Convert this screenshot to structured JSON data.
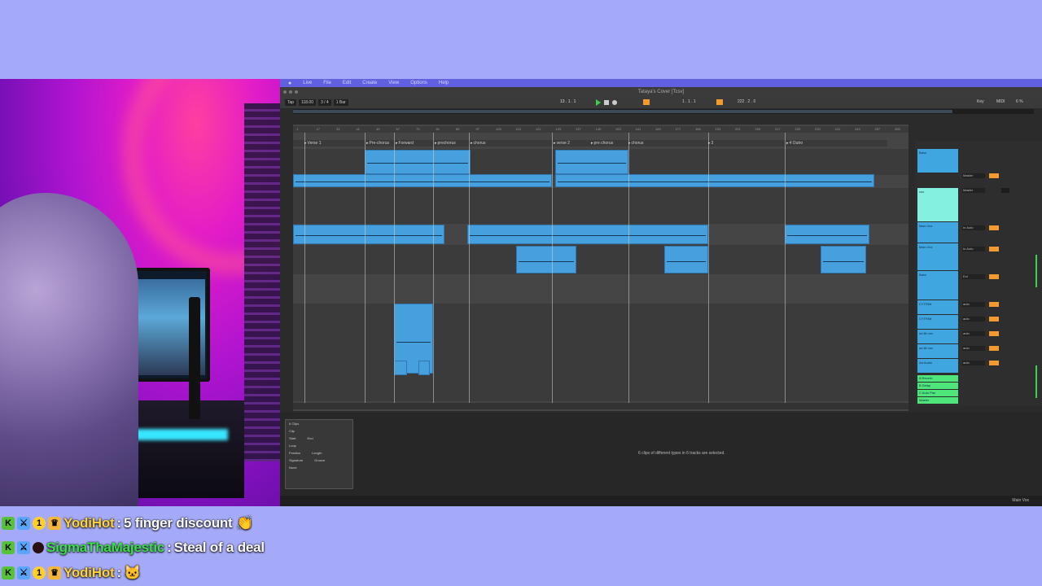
{
  "daw": {
    "menu": [
      "Live",
      "File",
      "Edit",
      "Create",
      "View",
      "Options",
      "Help"
    ],
    "window_title": "Tataya's Cover [Tcsv]",
    "tempo": "118.00",
    "signature": "3 / 4",
    "quantize": "1 Bar",
    "tap_label": "Tap",
    "position": "13 . 1 . 1",
    "loop_start": "1 . 1 . 1",
    "loop_length": "222 . 2 . 0",
    "key_label": "Key",
    "midi_label": "MIDI",
    "cpu": "6 %",
    "ruler_ticks": [
      "1",
      "17",
      "33",
      "41",
      "49",
      "57",
      "73",
      "81",
      "89",
      "97",
      "105",
      "113",
      "121",
      "129",
      "137",
      "145",
      "153",
      "161",
      "169",
      "177",
      "185",
      "193",
      "201",
      "209",
      "217",
      "225",
      "233",
      "241",
      "249",
      "257",
      "265"
    ],
    "locators": [
      {
        "label": "Verse 1"
      },
      {
        "label": "Pre-chorus"
      },
      {
        "label": "Forward"
      },
      {
        "label": "prechorus"
      },
      {
        "label": "chorus"
      },
      {
        "label": "verse 2"
      },
      {
        "label": "pre chorus"
      },
      {
        "label": "chorus"
      },
      {
        "label": "3"
      },
      {
        "label": "4 Outro"
      }
    ],
    "mixer_tracks": [
      {
        "name": "Bass",
        "io": "Master"
      },
      {
        "name": "vox",
        "io": "Master"
      },
      {
        "name": "Main Vox",
        "io": "In Auto"
      },
      {
        "name": "Main Vox",
        "io": "In Auto"
      },
      {
        "name": "Bass",
        "io": "Ext"
      },
      {
        "name": "CYTRIM",
        "io": "auto"
      },
      {
        "name": "CYTRIM",
        "io": "auto"
      },
      {
        "name": "ad-lib vox",
        "io": "auto"
      },
      {
        "name": "ad-lib vox",
        "io": "auto"
      },
      {
        "name": "Ad Audio",
        "io": "auto"
      }
    ],
    "returns": [
      "A Reverb",
      "B Delay",
      "C Auto Pan",
      "Master"
    ],
    "clip_panel": {
      "title": "6 Clips",
      "clip_label": "Clip",
      "start": "Start",
      "end": "End",
      "loop": "Loop",
      "position": "Position",
      "length": "Length",
      "signature": "Signature",
      "groove": "Groove",
      "groove_value": "None"
    },
    "detail_message": "6 clips of different types in 6 tracks are selected.",
    "status_right": "Main Vox"
  },
  "chat": [
    {
      "user": "YodiHot",
      "message": "5 finger discount 👏"
    },
    {
      "user": "SigmaThaMajestic",
      "message": "Steal of a deal"
    },
    {
      "user": "YodiHot",
      "message": "🐱"
    }
  ],
  "colors": {
    "background": "#a5aaf8",
    "clip_blue": "#46a0de",
    "accent_orange": "#f29a2e",
    "mixer_green": "#4ee57b"
  }
}
